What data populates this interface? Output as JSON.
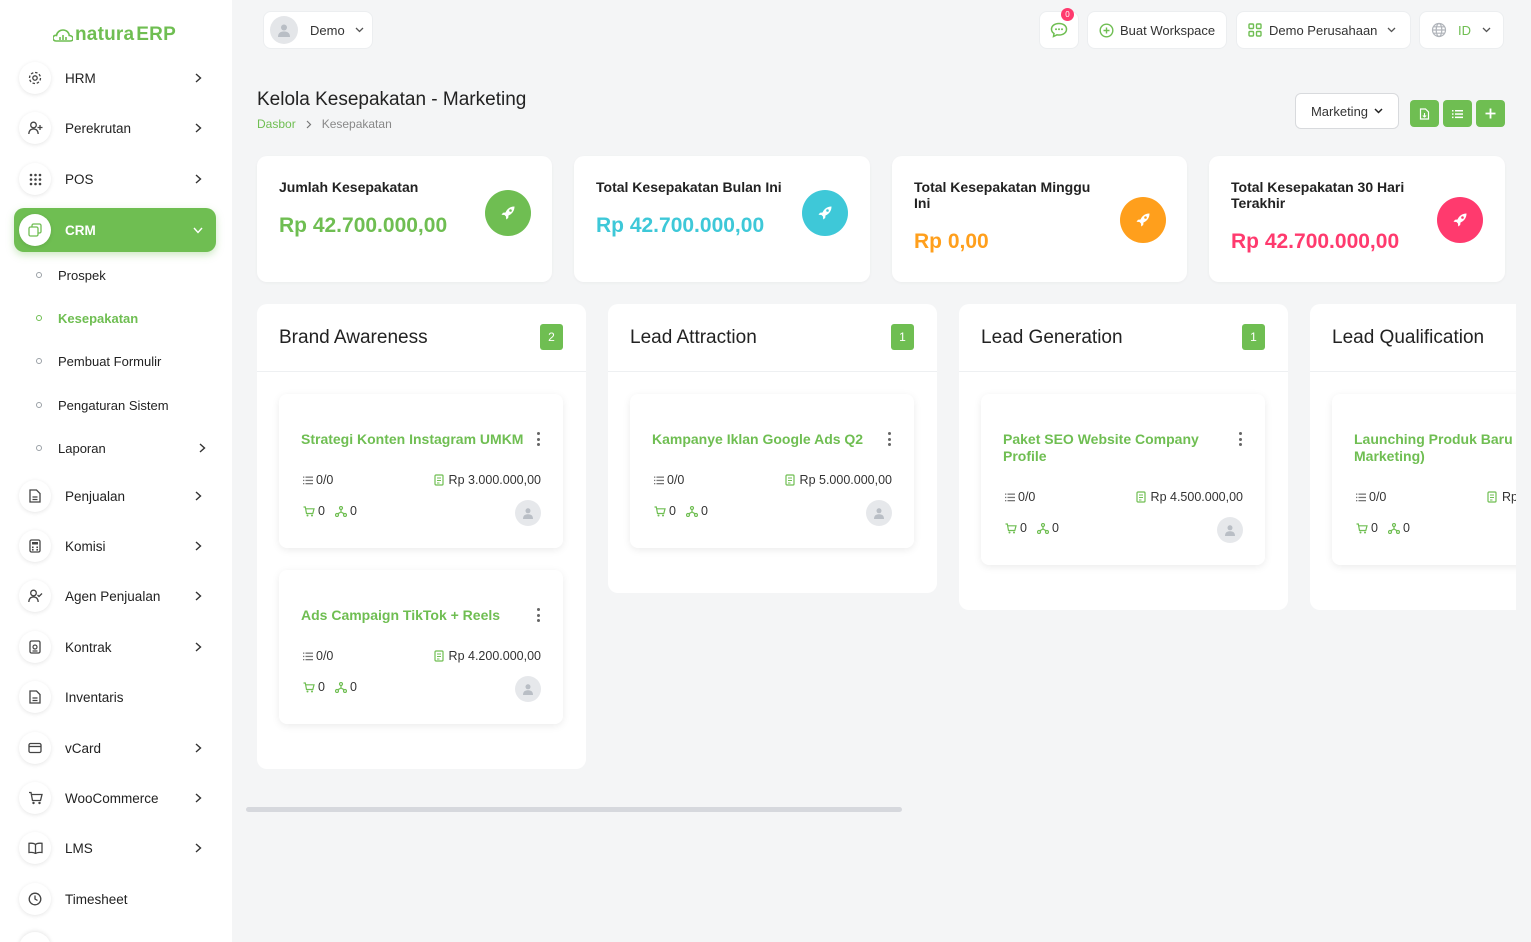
{
  "app": {
    "logo_prefix": "natura",
    "logo_suffix": "ERP"
  },
  "sidebar": {
    "items": [
      {
        "label": "HRM"
      },
      {
        "label": "Perekrutan"
      },
      {
        "label": "POS"
      },
      {
        "label": "CRM"
      },
      {
        "label": "Penjualan"
      },
      {
        "label": "Komisi"
      },
      {
        "label": "Agen Penjualan"
      },
      {
        "label": "Kontrak"
      },
      {
        "label": "Inventaris"
      },
      {
        "label": "vCard"
      },
      {
        "label": "WooCommerce"
      },
      {
        "label": "LMS"
      },
      {
        "label": "Timesheet"
      }
    ],
    "crm_sub": [
      {
        "label": "Prospek"
      },
      {
        "label": "Kesepakatan"
      },
      {
        "label": "Pembuat Formulir"
      },
      {
        "label": "Pengaturan Sistem"
      },
      {
        "label": "Laporan"
      }
    ]
  },
  "header": {
    "user_name": "Demo",
    "notif_count": "0",
    "workspace_btn": "Buat Workspace",
    "company_btn": "Demo Perusahaan",
    "language": "ID"
  },
  "page": {
    "title": "Kelola Kesepakatan - Marketing",
    "breadcrumb_home": "Dasbor",
    "breadcrumb_current": "Kesepakatan",
    "pipeline_select": "Marketing"
  },
  "stats": [
    {
      "title": "Jumlah Kesepakatan",
      "value": "Rp 42.700.000,00",
      "color": "#6fbe52"
    },
    {
      "title": "Total Kesepakatan Bulan Ini",
      "value": "Rp 42.700.000,00",
      "color": "#3ec8d8"
    },
    {
      "title": "Total Kesepakatan Minggu Ini",
      "value": "Rp 0,00",
      "color": "#ff9f1c"
    },
    {
      "title": "Total Kesepakatan 30 Hari Terakhir",
      "value": "Rp 42.700.000,00",
      "color": "#ff3a6e"
    }
  ],
  "columns": [
    {
      "title": "Brand Awareness",
      "count": "2",
      "cards": [
        {
          "title": "Strategi Konten Instagram UMKM",
          "tasks": "0/0",
          "price": "Rp 3.000.000,00",
          "products": "0",
          "sources": "0"
        },
        {
          "title": "Ads Campaign TikTok + Reels",
          "tasks": "0/0",
          "price": "Rp 4.200.000,00",
          "products": "0",
          "sources": "0"
        }
      ]
    },
    {
      "title": "Lead Attraction",
      "count": "1",
      "cards": [
        {
          "title": "Kampanye Iklan Google Ads Q2",
          "tasks": "0/0",
          "price": "Rp 5.000.000,00",
          "products": "0",
          "sources": "0"
        }
      ]
    },
    {
      "title": "Lead Generation",
      "count": "1",
      "cards": [
        {
          "title": "Paket SEO Website Company Profile",
          "tasks": "0/0",
          "price": "Rp 4.500.000,00",
          "products": "0",
          "sources": "0"
        }
      ]
    },
    {
      "title": "Lead Qualification",
      "count": "",
      "cards": [
        {
          "title": "Launching Produk Baru Marketing)",
          "tasks": "0/0",
          "price": "Rp",
          "products": "0",
          "sources": "0"
        }
      ]
    }
  ],
  "colors": {
    "accent": "#6fbe52",
    "text": "#222222",
    "muted": "#888888",
    "notif": "#ff3a6e"
  }
}
